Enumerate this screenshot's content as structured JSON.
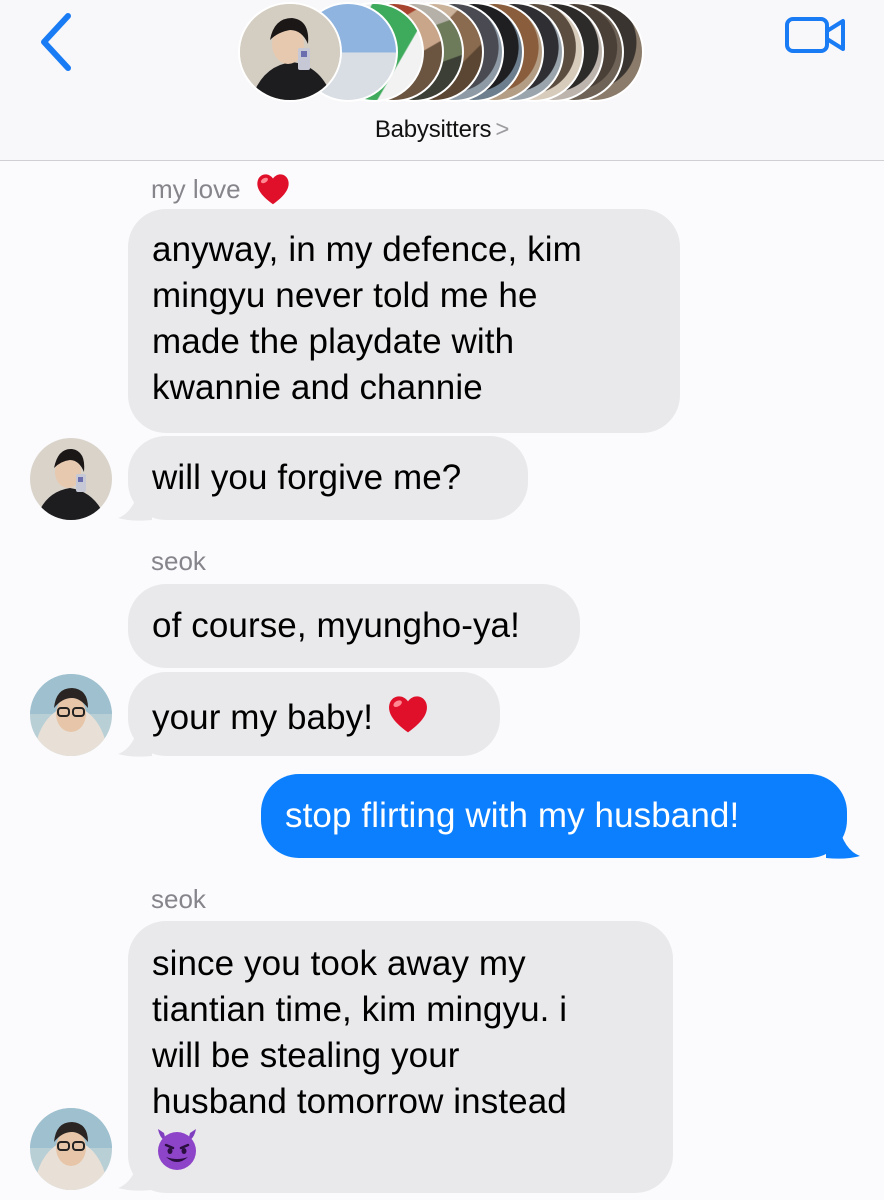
{
  "header": {
    "group_name": "Babysitters",
    "chevron": ">",
    "back_icon": "chevron-left-icon",
    "video_icon": "video-camera-icon",
    "accent": "#1a7cf5"
  },
  "messages": [
    {
      "sender": "my love",
      "sender_emoji": "heart",
      "lines": [
        "anyway, in my defence, kim",
        "mingyu never told me he",
        "made the playdate with",
        "kwannie and channie"
      ]
    },
    {
      "lines": [
        "will you forgive me?"
      ]
    },
    {
      "sender": "seok",
      "lines": [
        "of course, myungho-ya!"
      ]
    },
    {
      "lines": [
        "your my baby!"
      ],
      "emoji": "heart"
    },
    {
      "outgoing": true,
      "lines": [
        "stop flirting with my husband!"
      ]
    },
    {
      "sender": "seok",
      "lines": [
        "since you took away my",
        "tiantian time, kim mingyu. i",
        "will be stealing your",
        "husband tomorrow instead"
      ],
      "emoji": "smiling-devil"
    }
  ],
  "colors": {
    "incoming_bubble": "#e9e9eb",
    "outgoing_bubble": "#0b7ffe",
    "sender_label": "#85858b",
    "background": "#fbfbfd"
  }
}
